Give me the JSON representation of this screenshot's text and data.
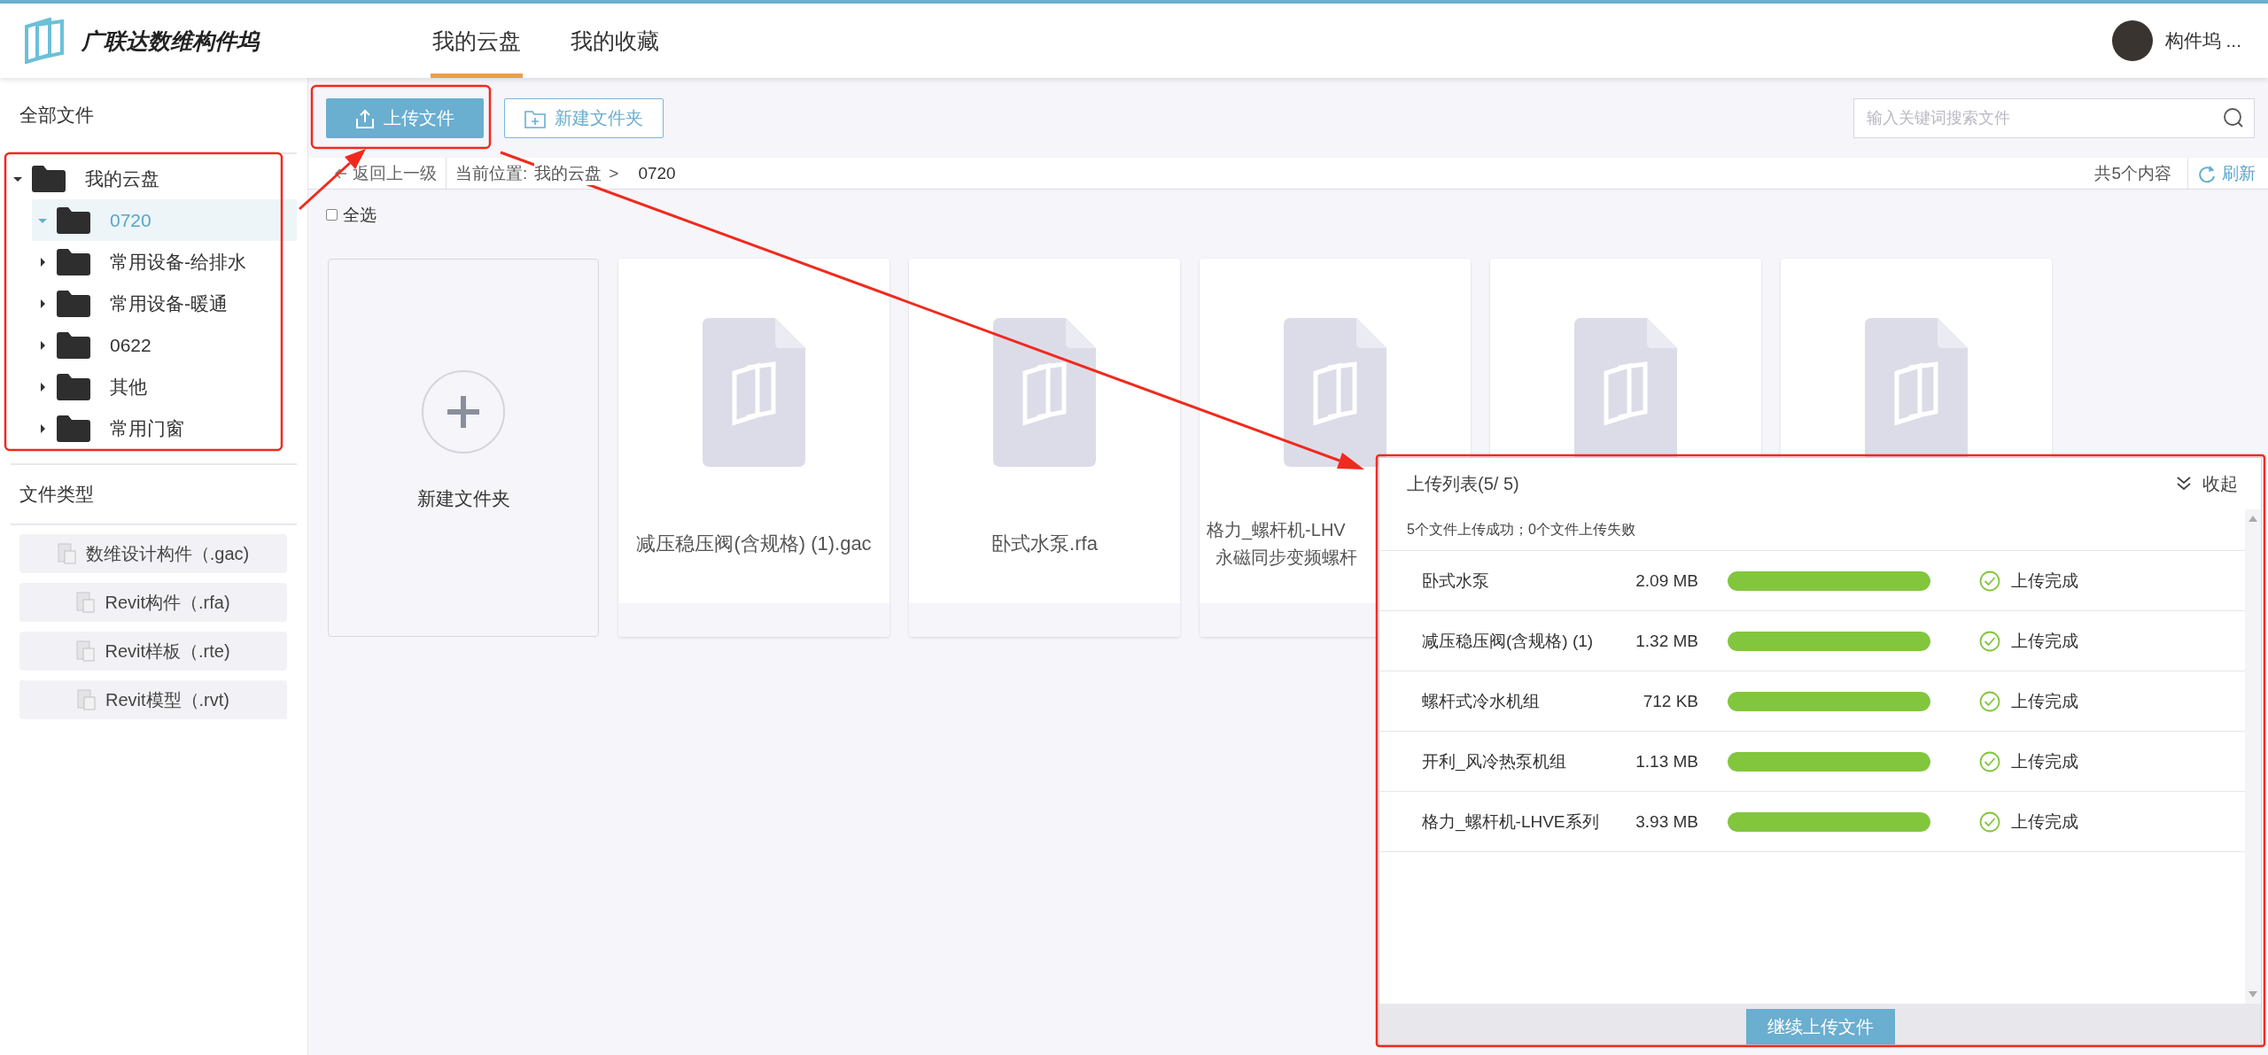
{
  "header": {
    "brand": "广联达数维构件坞",
    "tabs": [
      {
        "label": "我的云盘",
        "selected": true
      },
      {
        "label": "我的收藏",
        "selected": false
      }
    ],
    "user": "构件坞 ..."
  },
  "sidebar": {
    "all_files_title": "全部文件",
    "tree": [
      {
        "label": "我的云盘",
        "expanded": true,
        "selected": false,
        "children": [
          {
            "label": "0720",
            "expanded": true,
            "selected": true
          },
          {
            "label": "常用设备-给排水",
            "expanded": false,
            "selected": false
          },
          {
            "label": "常用设备-暖通",
            "expanded": false,
            "selected": false
          },
          {
            "label": "0622",
            "expanded": false,
            "selected": false
          },
          {
            "label": "其他",
            "expanded": false,
            "selected": false
          },
          {
            "label": "常用门窗",
            "expanded": false,
            "selected": false
          }
        ]
      }
    ],
    "file_types_title": "文件类型",
    "file_types": [
      {
        "label": "数维设计构件（.gac)"
      },
      {
        "label": "Revit构件（.rfa)"
      },
      {
        "label": "Revit样板（.rte)"
      },
      {
        "label": "Revit模型（.rvt)"
      }
    ]
  },
  "toolbar": {
    "upload_button": "上传文件",
    "new_folder_button": "新建文件夹",
    "search": {
      "placeholder": "输入关键词搜索文件"
    }
  },
  "breadcrumb": {
    "back": "返回上一级",
    "location_label": "当前位置:",
    "path": [
      "我的云盘",
      "0720"
    ],
    "separator": ">",
    "count": "共5个内容",
    "refresh": "刷新"
  },
  "select_all": {
    "label": "全选",
    "checked": false
  },
  "new_folder_card": {
    "label": "新建文件夹"
  },
  "files": [
    {
      "kind": "file",
      "name_lines": [
        "减压稳压阀(含规格) (1).gac"
      ]
    },
    {
      "kind": "file",
      "name_lines": [
        "卧式水泵.rfa"
      ]
    },
    {
      "kind": "file",
      "name_lines": [
        "格力_螺杆机-LHV",
        "永磁同步变频螺杆"
      ]
    },
    {
      "kind": "file"
    },
    {
      "kind": "file"
    }
  ],
  "upload_panel": {
    "title": "上传列表(5/ 5)",
    "collapse": "收起",
    "summary": "5个文件上传成功；0个文件上传失败",
    "rows": [
      {
        "name": "卧式水泵",
        "size": "2.09 MB",
        "level": 1,
        "status": "上传完成"
      },
      {
        "name": "减压稳压阀(含规格) (1)",
        "size": "1.32 MB",
        "level": 1,
        "status": "上传完成"
      },
      {
        "name": "螺杆式冷水机组",
        "size": "712 KB",
        "level": 1,
        "status": "上传完成"
      },
      {
        "name": "开利_风冷热泵机组",
        "size": "1.13 MB",
        "level": 1,
        "status": "上传完成"
      },
      {
        "name": "格力_螺杆机-LHVE系列",
        "size": "3.93 MB",
        "level": 1,
        "status": "上传完成"
      }
    ],
    "continue_button": "继续上传文件"
  }
}
